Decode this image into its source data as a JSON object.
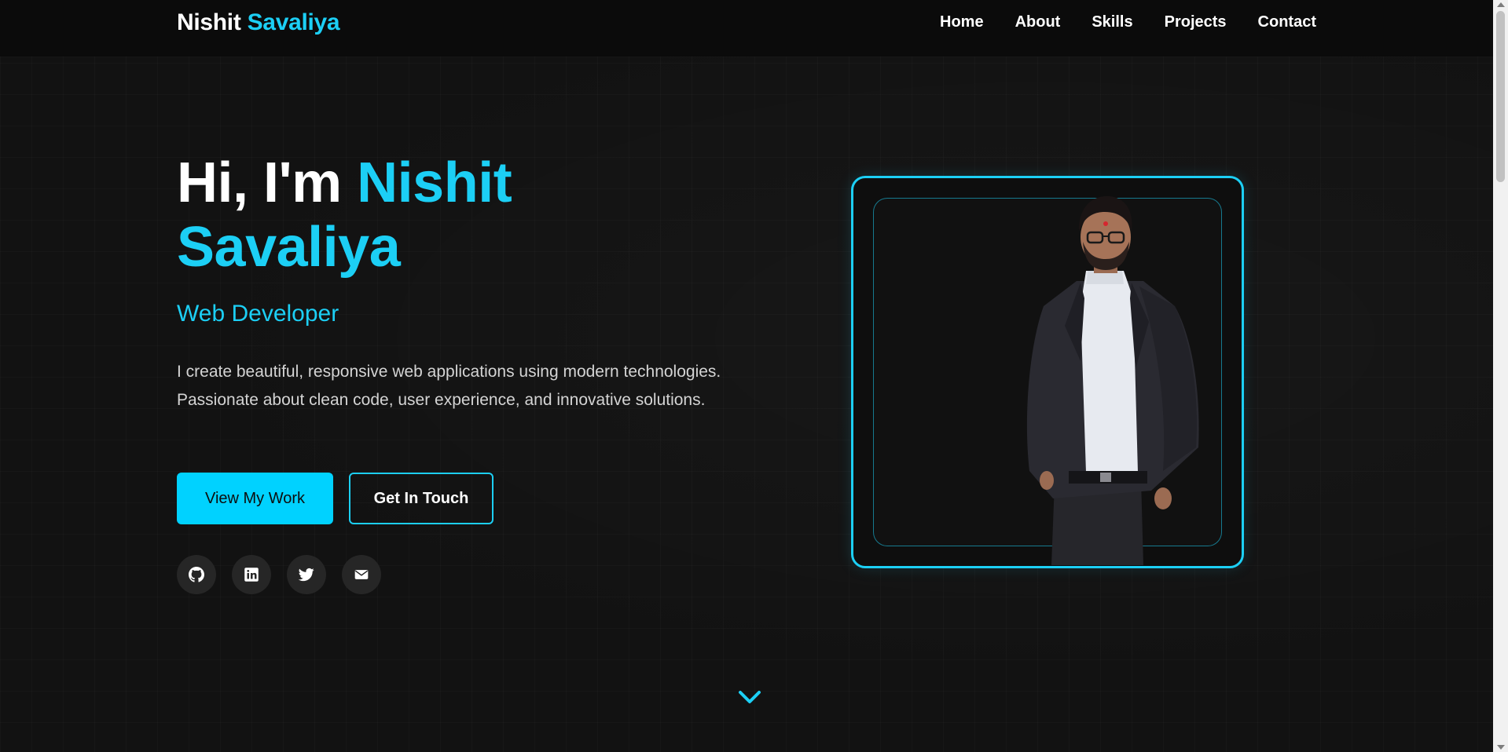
{
  "brand": {
    "first": "Nishit",
    "last": "Savaliya"
  },
  "nav": {
    "items": [
      {
        "label": "Home"
      },
      {
        "label": "About"
      },
      {
        "label": "Skills"
      },
      {
        "label": "Projects"
      },
      {
        "label": "Contact"
      }
    ]
  },
  "hero": {
    "greeting": "Hi, I'm",
    "name_first": "Nishit",
    "name_last": "Savaliya",
    "role": "Web Developer",
    "description": "I create beautiful, responsive web applications using modern technologies. Passionate about clean code, user experience, and innovative solutions.",
    "primary_button": "View My Work",
    "secondary_button": "Get In Touch"
  },
  "socials": [
    {
      "icon": "github-icon"
    },
    {
      "icon": "linkedin-icon"
    },
    {
      "icon": "twitter-icon"
    },
    {
      "icon": "email-icon"
    }
  ],
  "scroll_indicator": {
    "icon": "chevron-down-icon"
  },
  "colors": {
    "accent": "#1ccff5",
    "primary_button": "#00d2ff",
    "background": "#121212",
    "navbar": "#0b0b0b"
  }
}
